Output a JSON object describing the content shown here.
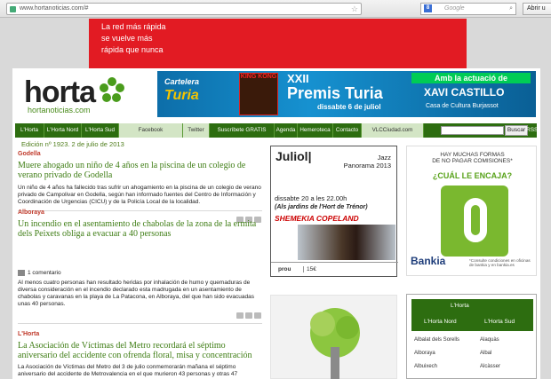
{
  "browser": {
    "url": "www.hortanoticias.com/#",
    "search_placeholder": "Google",
    "g_label": "8",
    "open_label": "Abrir u"
  },
  "top_ad": {
    "line1": "La red más rápida",
    "line2": "se vuelve más",
    "line3": "rápida que nunca"
  },
  "logo": {
    "word": "horta",
    "sub": "hortanoticias.com"
  },
  "header_banner": {
    "cartelera": "Cartelera",
    "turia": "Turia",
    "kingkong": "KING KONG",
    "xxii": "XXII",
    "premis": "Premis Turia",
    "date": "dissabte 6 de juliol",
    "amb": "Amb la actuació de",
    "artist": "XAVI CASTILLO",
    "venue": "Casa de Cultura Burjassot"
  },
  "nav": {
    "items": [
      "L'Horta",
      "L'Horta Nord",
      "L'Horta Sud",
      "Facebook",
      "Twitter",
      "Suscríbete GRATIS",
      "Agenda",
      "Hemeroteca",
      "Contacto",
      "VLCCiudad.com"
    ],
    "search_button": "Buscar",
    "rss": "RSS"
  },
  "edition": "Edición nº 1923.    2 de julio de 2013",
  "articles": [
    {
      "section": "Godella",
      "headline": "Muere ahogado un niño de 4 años en la piscina de un colegio de verano privado de Godella",
      "body": "Un niño de 4 años ha fallecido tras sufrir un ahogamiento en la piscina de un colegio de verano privado de Campolivar en Godella, según han informado fuentes del Centro de Información y Coordinación de Urgencias (CICU) y de la Policía Local de la localidad."
    },
    {
      "section": "Alboraya",
      "headline": "Un incendio en el asentamiento de chabolas de la zona de la ermita dels Peixets obliga a evacuar a 40 personas",
      "comments": "1 comentario",
      "body": "Al menos cuatro personas han resultado heridas por inhalación de humo y quemaduras de diversa consideración en el incendio declarado esta madrugada en un asentamiento de chabolas y caravanas en la playa de La Patacona, en Alboraya, del que han sido evacuadas unas 40 personas."
    },
    {
      "section": "L'Horta",
      "headline": "La Asociación de Víctimas del Metro recordará el séptimo aniversario del accidente con ofrenda floral, misa y concentración",
      "body": "La Asociación de Víctimas del Metro del 3 de julio conmemorarán mañana el séptimo aniversario del accidente de Metrovalencia en el que murieron 43 personas y otras 47"
    }
  ],
  "event": {
    "title": "Juliol",
    "genre": "Jazz",
    "series": "Panorama 2013",
    "when": "dissabte 20 a les 22.00h",
    "where": "(Als jardins de l'Hort de Trénor)",
    "who": "SHEMEKIA COPELAND",
    "tag": "prou",
    "price": "15€"
  },
  "bank_ad": {
    "line1": "HAY MUCHAS FORMAS",
    "line2": "DE NO PAGAR COMISIONES*",
    "question": "¿CUÁL LE ENCAJA?",
    "brand": "Bankia",
    "fine": "*Consulte condiciones en oficinas de bankia y en bankia.es"
  },
  "horta_box": {
    "tab1": "L'Horta",
    "tab2": "L'Horta Nord",
    "tab3": "L'Horta Sud",
    "left_links": [
      "Albalat dels Sorells",
      "Alboraya",
      "Albuixech"
    ],
    "right_links": [
      "Alaquàs",
      "Albal",
      "Alcàsser"
    ]
  },
  "colors": {
    "nav_green": "#2d6d10",
    "headline_green": "#3e7d14",
    "section_red": "#c03a2b",
    "ad_red": "#e21b23"
  }
}
